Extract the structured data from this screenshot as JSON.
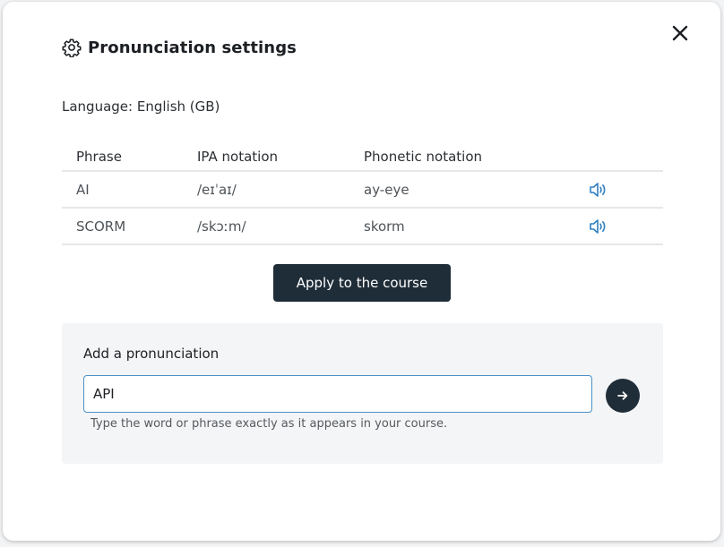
{
  "dialog": {
    "title": "Pronunciation settings",
    "language": "Language: English (GB)",
    "icons": {
      "title": "gear-icon",
      "close": "close-icon",
      "play": "speaker-icon",
      "submit": "arrow-right-icon"
    }
  },
  "table": {
    "headers": {
      "phrase": "Phrase",
      "ipa": "IPA notation",
      "phonetic": "Phonetic notation"
    },
    "rows": [
      {
        "phrase": "AI",
        "ipa": "/eɪˈaɪ/",
        "phonetic": "ay-eye"
      },
      {
        "phrase": "SCORM",
        "ipa": "/skɔːm/",
        "phonetic": "skorm"
      }
    ]
  },
  "apply_button": "Apply to the course",
  "add": {
    "label": "Add a pronunciation",
    "value": "API",
    "hint": "Type the word or phrase exactly as it appears in your course."
  },
  "colors": {
    "dark_button": "#1f2d38",
    "accent_blue": "#2f7fc1",
    "input_border": "#4a90c9"
  }
}
